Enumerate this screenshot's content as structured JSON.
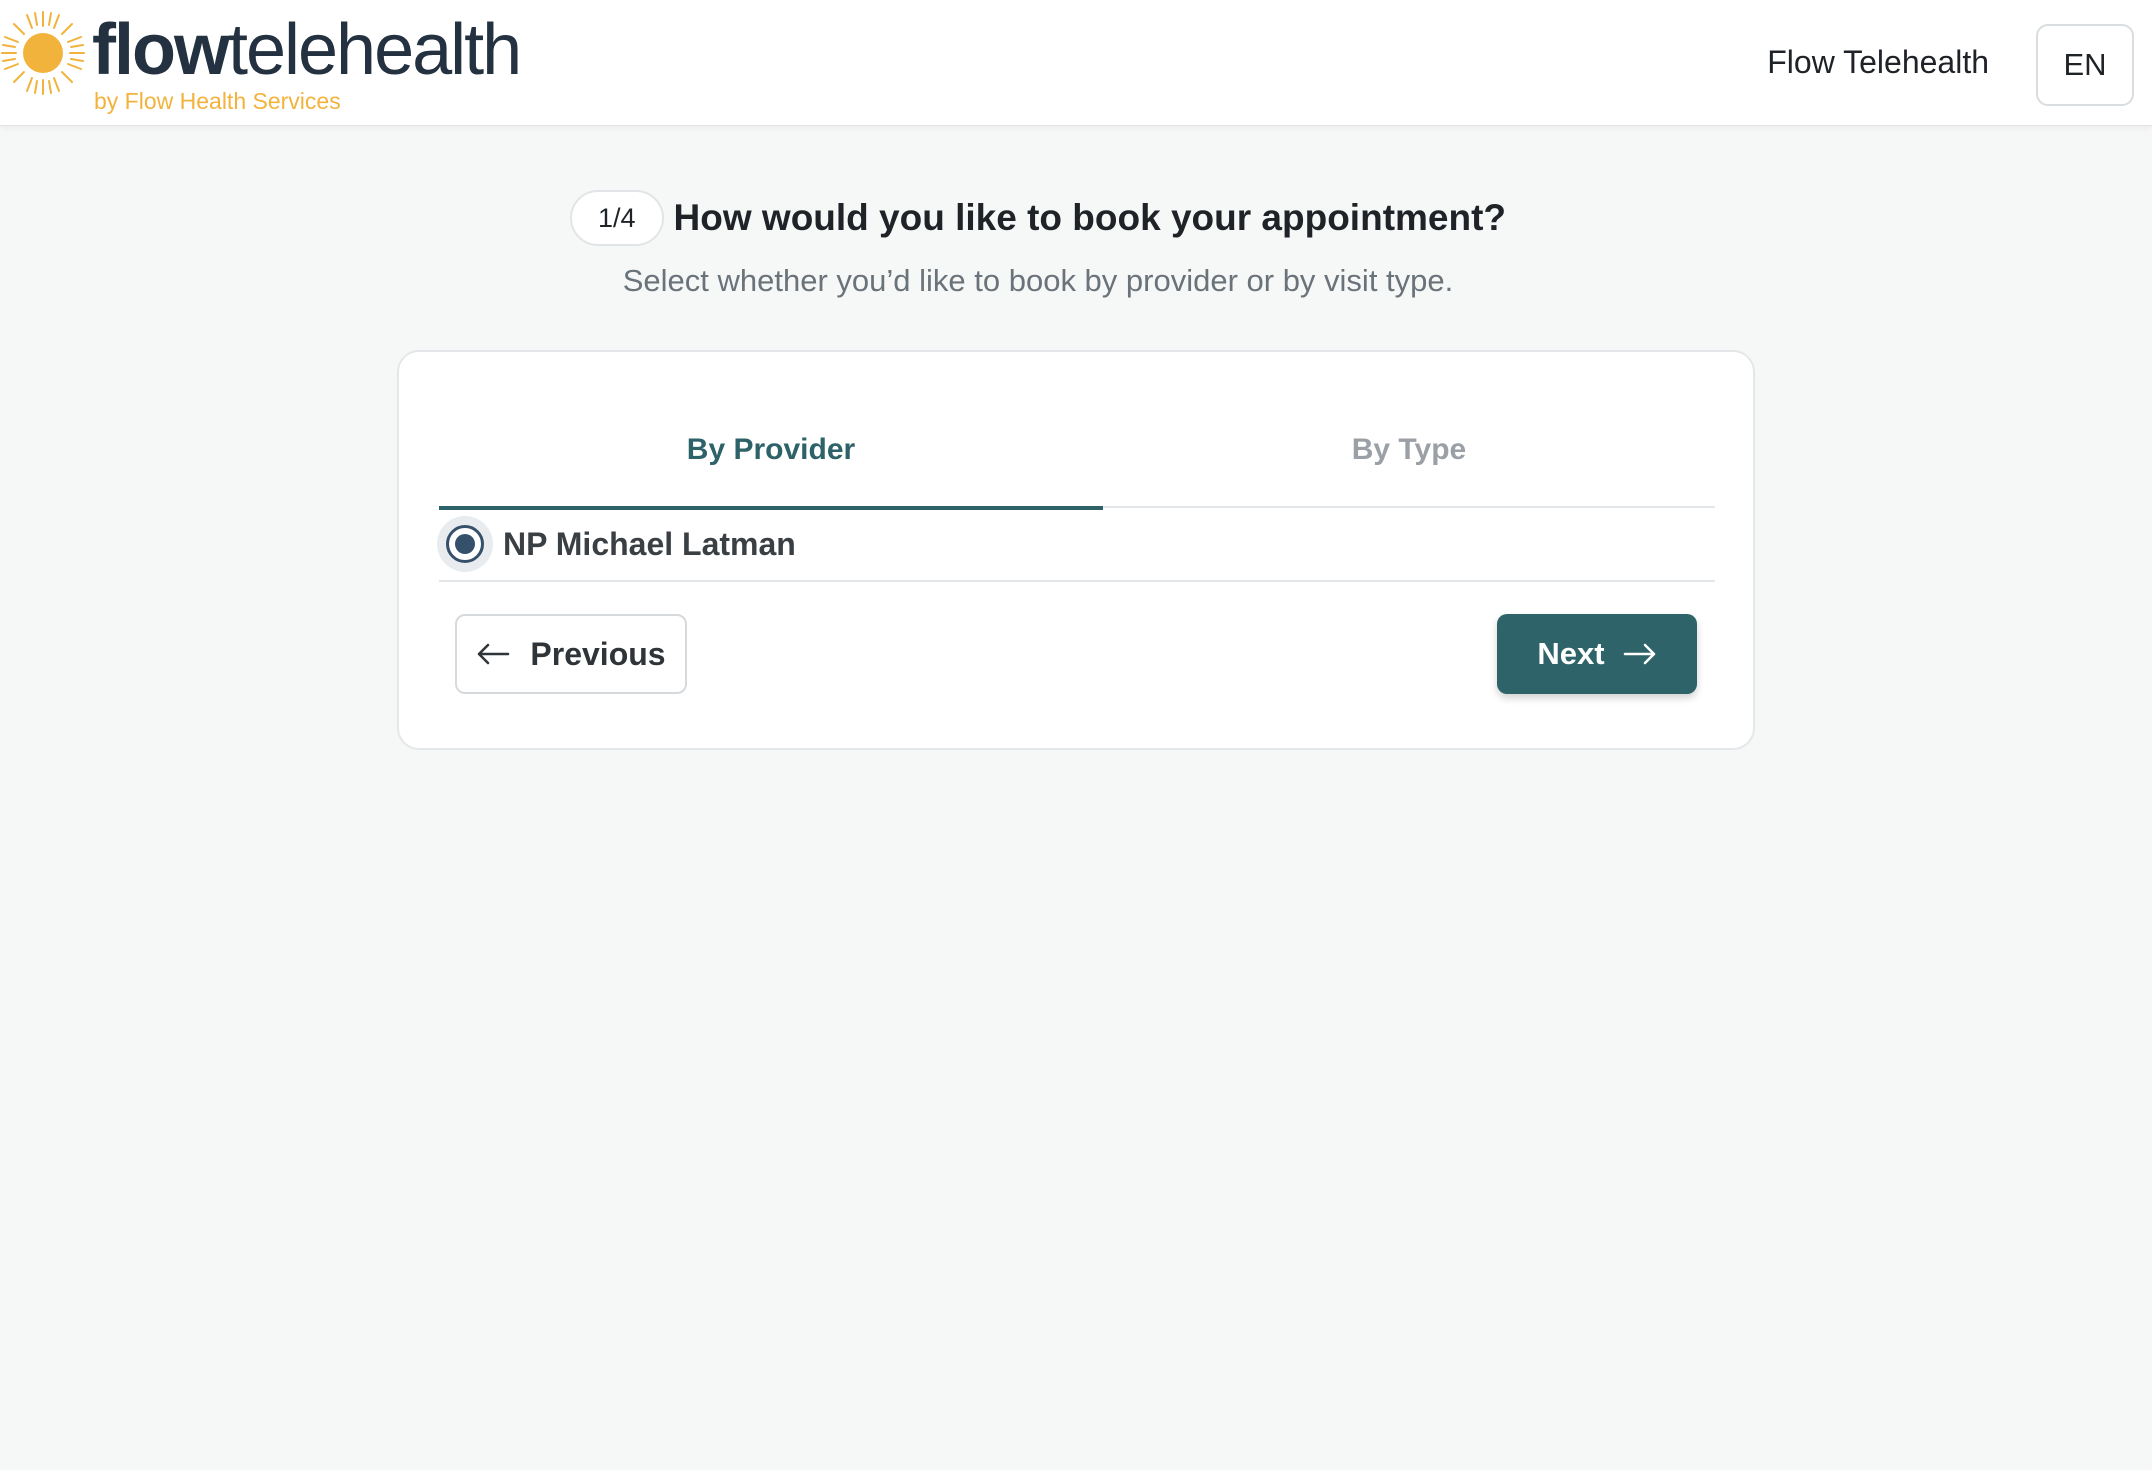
{
  "header": {
    "logo": {
      "wordmark_bold": "flow",
      "wordmark_light": "telehealth",
      "tagline": "by Flow Health Services",
      "sun_color": "#f2b33d"
    },
    "link_label": "Flow Telehealth",
    "language": "EN"
  },
  "wizard": {
    "step": "1/4",
    "title": "How would you like to book your appointment?",
    "subtitle": "Select whether you’d like to book by provider or by visit type."
  },
  "card": {
    "tabs": [
      {
        "label": "By Provider",
        "active": true
      },
      {
        "label": "By Type",
        "active": false
      }
    ],
    "options": [
      {
        "label": "NP Michael Latman",
        "selected": true
      }
    ],
    "previous_label": "Previous",
    "next_label": "Next"
  },
  "colors": {
    "accent": "#2e6369",
    "radio": "#34506b",
    "brand_dark": "#233140",
    "brand_yellow": "#f2b33d",
    "background": "#f6f7f7"
  },
  "icons": {
    "previous": "arrow-left-icon",
    "next": "arrow-right-icon",
    "logo": "sun-icon"
  }
}
